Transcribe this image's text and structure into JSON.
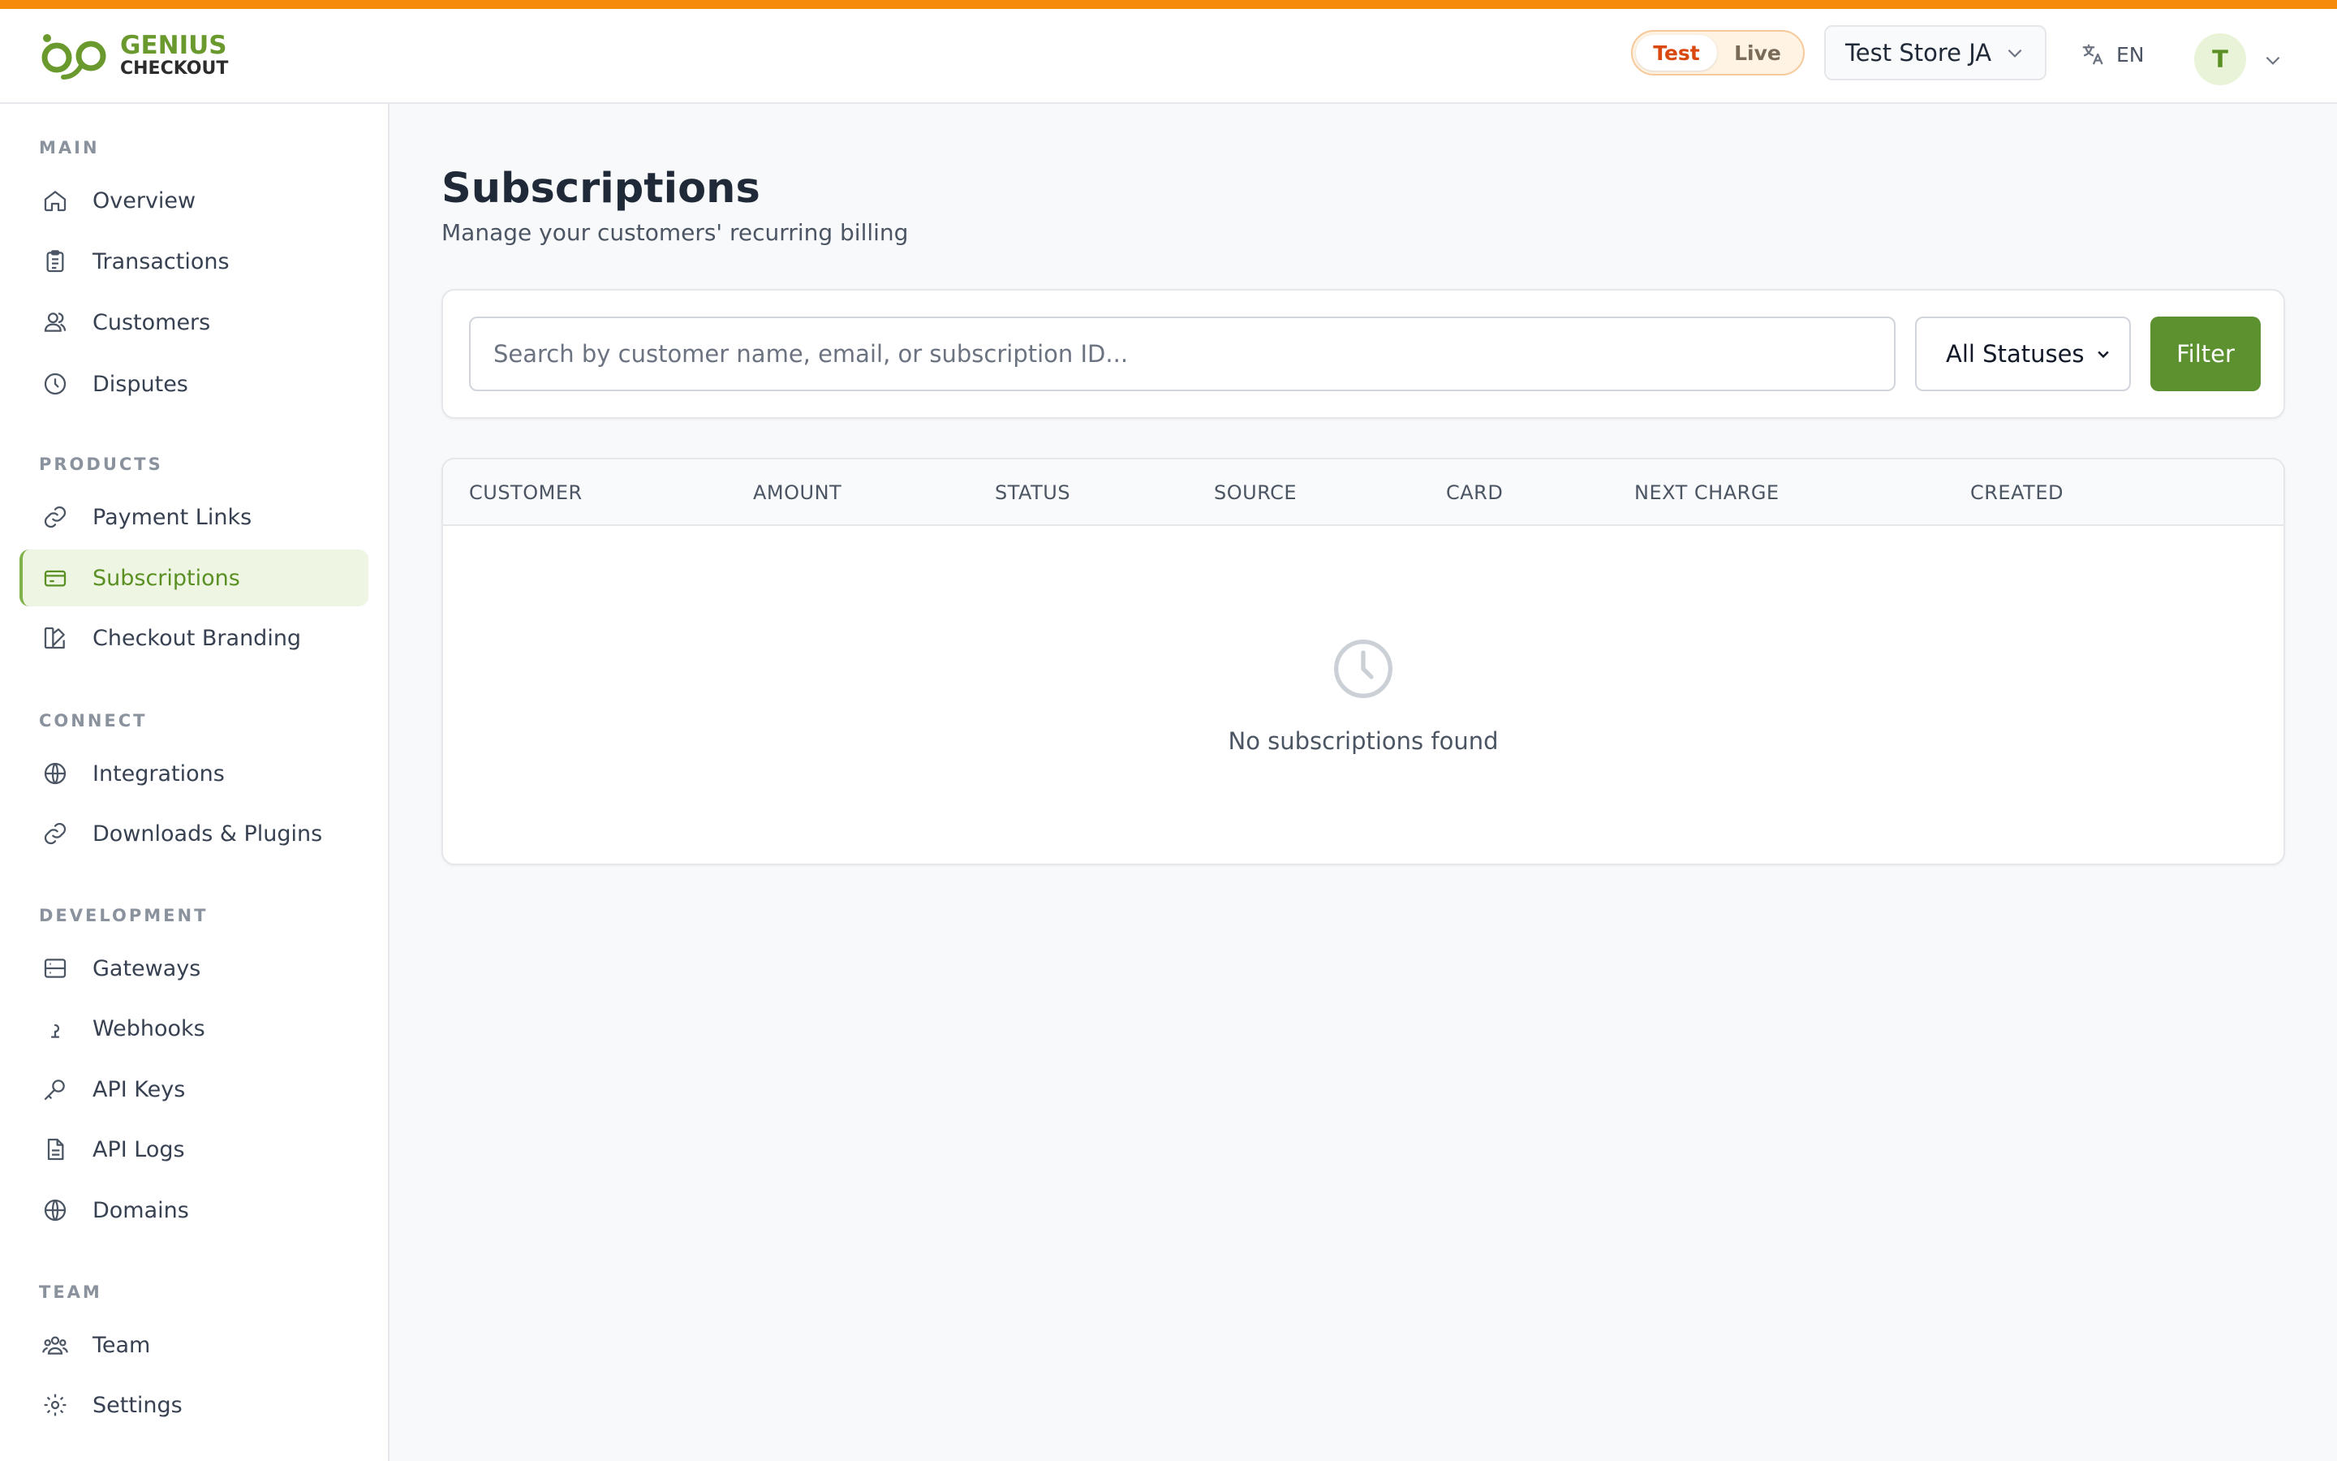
{
  "brand": {
    "line1": "GENIUS",
    "line2": "CHECKOUT",
    "accent": "#6a9a2e",
    "stripe": "#f58a0b"
  },
  "header": {
    "mode": {
      "test": "Test",
      "live": "Live",
      "active": "test"
    },
    "store": "Test Store JA",
    "language": "EN",
    "avatar_initial": "T"
  },
  "sidebar": {
    "sections": [
      {
        "title": "MAIN",
        "items": [
          {
            "label": "Overview",
            "icon": "home-icon"
          },
          {
            "label": "Transactions",
            "icon": "clipboard-icon"
          },
          {
            "label": "Customers",
            "icon": "users-icon"
          },
          {
            "label": "Disputes",
            "icon": "clock-icon"
          }
        ]
      },
      {
        "title": "PRODUCTS",
        "items": [
          {
            "label": "Payment Links",
            "icon": "link-icon"
          },
          {
            "label": "Subscriptions",
            "icon": "card-icon",
            "active": true
          },
          {
            "label": "Checkout Branding",
            "icon": "palette-icon"
          }
        ]
      },
      {
        "title": "CONNECT",
        "items": [
          {
            "label": "Integrations",
            "icon": "globe-icon"
          },
          {
            "label": "Downloads & Plugins",
            "icon": "link-icon"
          }
        ]
      },
      {
        "title": "DEVELOPMENT",
        "items": [
          {
            "label": "Gateways",
            "icon": "server-icon"
          },
          {
            "label": "Webhooks",
            "icon": "webhook-icon"
          },
          {
            "label": "API Keys",
            "icon": "key-icon"
          },
          {
            "label": "API Logs",
            "icon": "file-icon"
          },
          {
            "label": "Domains",
            "icon": "globe-icon"
          }
        ]
      },
      {
        "title": "TEAM",
        "items": [
          {
            "label": "Team",
            "icon": "team-icon"
          },
          {
            "label": "Settings",
            "icon": "gear-icon"
          }
        ]
      }
    ]
  },
  "main": {
    "title": "Subscriptions",
    "subtitle": "Manage your customers' recurring billing",
    "search_placeholder": "Search by customer name, email, or subscription ID...",
    "status_filter": "All Statuses",
    "filter_button": "Filter",
    "columns": [
      "CUSTOMER",
      "AMOUNT",
      "STATUS",
      "SOURCE",
      "CARD",
      "NEXT CHARGE",
      "CREATED"
    ],
    "empty_message": "No subscriptions found"
  }
}
